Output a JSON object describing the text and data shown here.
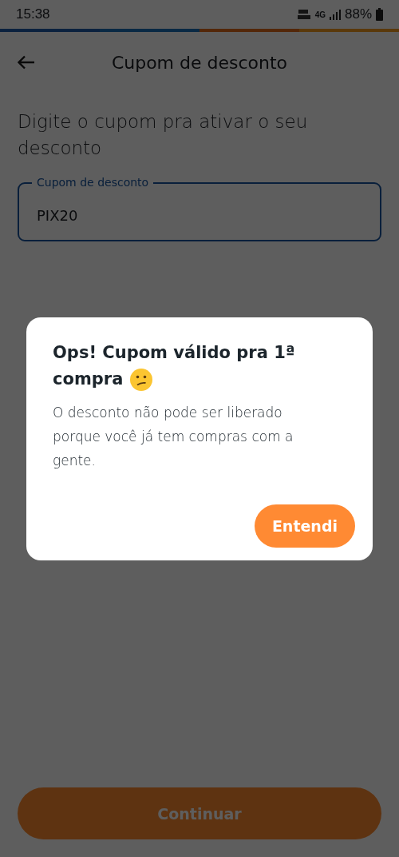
{
  "status_bar": {
    "time": "15:38",
    "network": "4G",
    "battery": "88%"
  },
  "header": {
    "title": "Cupom de desconto"
  },
  "prompt": "Digite o cupom pra ativar o seu desconto",
  "coupon_field": {
    "label": "Cupom de desconto",
    "value": "PIX20"
  },
  "continue_button": {
    "label": "Continuar"
  },
  "dialog": {
    "title_lines": [
      "Ops! Cupom válido pra 1ª",
      "compra"
    ],
    "message": "O desconto não pode ser liberado porque você já tem compras com a gente.",
    "button": "Entendi"
  }
}
